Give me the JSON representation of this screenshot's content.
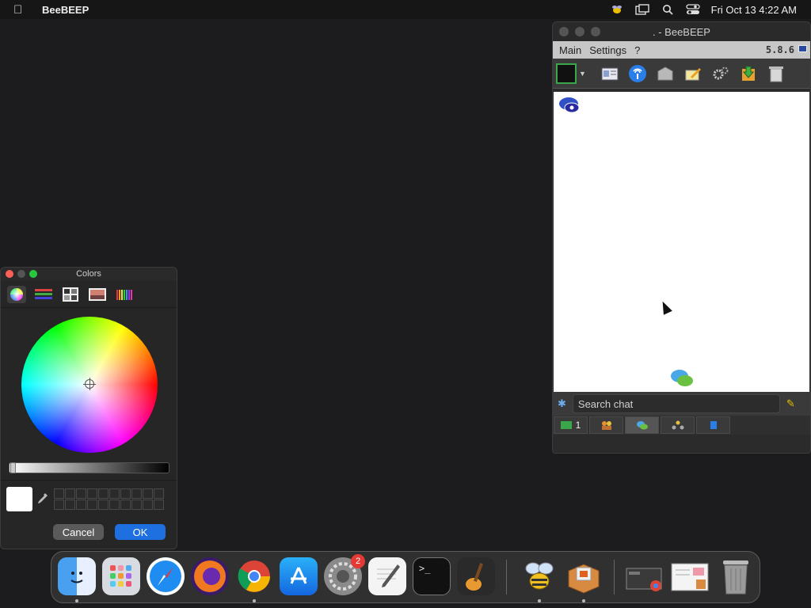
{
  "menubar": {
    "app_name": "BeeBEEP",
    "clock": "Fri Oct 13  4:22 AM",
    "icons": [
      "apple-icon",
      "beebeep-tray-icon",
      "screen-mirroring-icon",
      "spotlight-search-icon",
      "control-center-icon"
    ]
  },
  "beebeep": {
    "title": ". - BeeBEEP",
    "menu": {
      "main": "Main",
      "settings": "Settings",
      "help": "?"
    },
    "version": "5.8.6",
    "search_placeholder": "Search chat",
    "tabs": [
      {
        "icon": "users-online-icon",
        "count": "1"
      },
      {
        "icon": "groups-icon"
      },
      {
        "icon": "chats-icon"
      },
      {
        "icon": "network-icon"
      },
      {
        "icon": "files-icon"
      }
    ]
  },
  "colors_panel": {
    "title": "Colors",
    "modes": [
      "color-wheel",
      "color-sliders",
      "color-palettes",
      "image-palettes",
      "pencils"
    ],
    "selected_color": "#ffffff",
    "cancel": "Cancel",
    "ok": "OK"
  },
  "dock": {
    "apps": [
      "Finder",
      "Launchpad",
      "Safari",
      "Firefox",
      "Chrome",
      "App Store",
      "System Settings",
      "TextEdit",
      "Terminal",
      "GarageBand",
      "BeeBEEP",
      "Package Installer",
      "Screenshot",
      "Document",
      "Trash"
    ],
    "system_settings_badge": "2"
  }
}
